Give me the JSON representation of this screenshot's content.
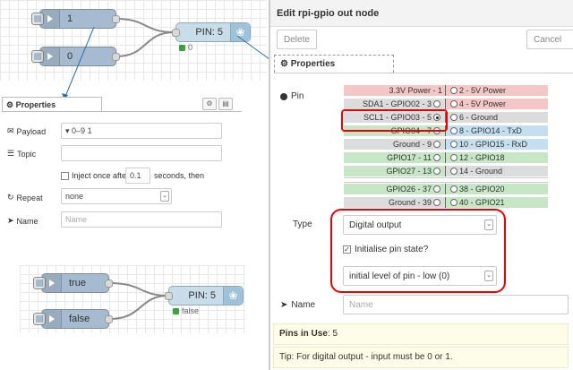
{
  "canvas_top": {
    "inject_nodes": [
      {
        "label": "1"
      },
      {
        "label": "0"
      }
    ],
    "out_node": {
      "label": "PIN: 5",
      "status": "0"
    }
  },
  "canvas_bottom": {
    "inject_nodes": [
      {
        "label": "true"
      },
      {
        "label": "false"
      }
    ],
    "out_node": {
      "label": "PIN: 5",
      "status": "false"
    }
  },
  "inject_panel": {
    "tab_label": "Properties",
    "payload_label": "Payload",
    "payload_type": "0–9",
    "payload_value": "1",
    "topic_label": "Topic",
    "topic_value": "",
    "inject_once_label": "Inject once after",
    "inject_once_value": "0.1",
    "inject_once_suffix": "seconds, then",
    "repeat_label": "Repeat",
    "repeat_value": "none",
    "name_label": "Name",
    "name_placeholder": "Name"
  },
  "edit_panel": {
    "title": "Edit rpi-gpio out node",
    "delete_label": "Delete",
    "cancel_label": "Cancel",
    "tab_label": "Properties",
    "pin_label": "Pin",
    "pins": [
      {
        "left": "3.3V Power - 1",
        "right": "2 - 5V Power",
        "left_color": "#f4c6c6",
        "right_color": "#f4c6c6",
        "left_radio": false,
        "right_radio": true,
        "selected": false
      },
      {
        "left": "SDA1 - GPIO02 - 3",
        "right": "4 - 5V Power",
        "left_color": "#dcdcdc",
        "right_color": "#f4c6c6",
        "left_radio": true,
        "right_radio": true,
        "selected": false
      },
      {
        "left": "SCL1 - GPIO03 - 5",
        "right": "6 - Ground",
        "left_color": "#dcdcdc",
        "right_color": "#dcdcdc",
        "left_radio": true,
        "right_radio": true,
        "selected": true
      },
      {
        "left": "GPIO04 - 7",
        "right": "8 - GPIO14 - TxD",
        "left_color": "#c6e6c6",
        "right_color": "#c6dff0",
        "left_radio": true,
        "right_radio": true,
        "selected": false
      },
      {
        "left": "Ground - 9",
        "right": "10 - GPIO15 - RxD",
        "left_color": "#dcdcdc",
        "right_color": "#c6dff0",
        "left_radio": true,
        "right_radio": true,
        "selected": false
      },
      {
        "left": "GPIO17 - 11",
        "right": "12 - GPIO18",
        "left_color": "#c6e6c6",
        "right_color": "#c6e6c6",
        "left_radio": true,
        "right_radio": true,
        "selected": false
      },
      {
        "left": "GPIO27 - 13",
        "right": "14 - Ground",
        "left_color": "#c6e6c6",
        "right_color": "#dcdcdc",
        "left_radio": true,
        "right_radio": true,
        "selected": false
      },
      {
        "left": "GPIO26 - 37",
        "right": "38 - GPIO20",
        "left_color": "#c6e6c6",
        "right_color": "#c6e6c6",
        "left_radio": true,
        "right_radio": true,
        "selected": false
      },
      {
        "left": "Ground - 39",
        "right": "40 - GPIO21",
        "left_color": "#dcdcdc",
        "right_color": "#c6e6c6",
        "left_radio": true,
        "right_radio": true,
        "selected": false
      }
    ],
    "type_label": "Type",
    "type_value": "Digital output",
    "init_label": "Initialise pin state?",
    "init_checked": true,
    "level_value": "initial level of pin - low (0)",
    "name_label": "Name",
    "name_placeholder": "Name",
    "pins_in_use_label": "Pins in Use",
    "pins_in_use_value": ": 5",
    "tip": "Tip: For digital output - input must be 0 or 1."
  }
}
